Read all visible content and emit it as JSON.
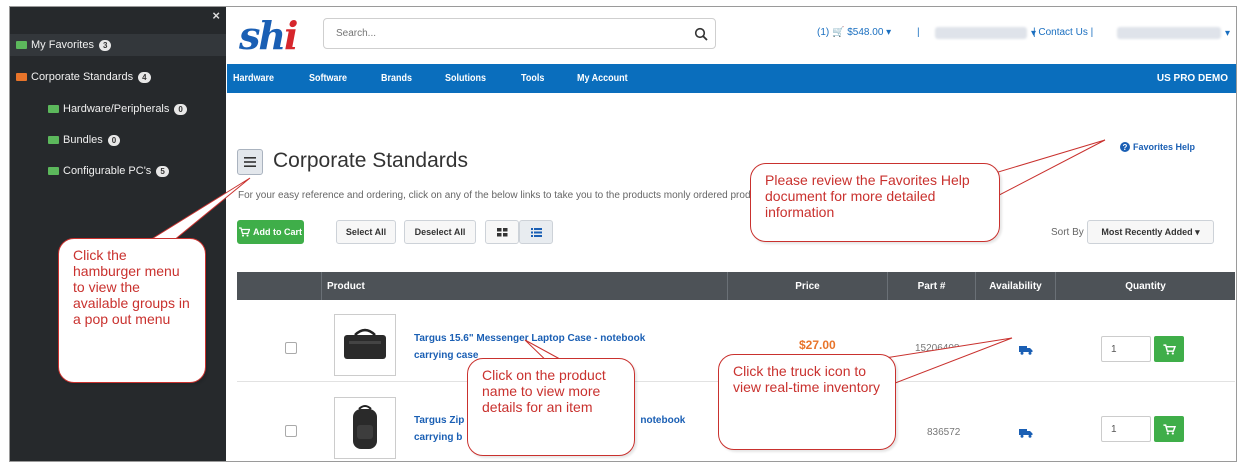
{
  "sidebar": {
    "close": "×",
    "items": [
      {
        "label": "My Favorites",
        "count": "3"
      },
      {
        "label": "Corporate Standards",
        "count": "4"
      },
      {
        "label": "Hardware/Peripherals",
        "count": "0"
      },
      {
        "label": "Bundles",
        "count": "0"
      },
      {
        "label": "Configurable PC's",
        "count": "5"
      }
    ]
  },
  "header": {
    "logo_text": "sh",
    "logo_i": "i",
    "search_placeholder": "Search...",
    "cart": "(1) 🛒 $548.00 ▾",
    "sep1": "|",
    "dropdown_caret": "▾",
    "contact": "| Contact Us |"
  },
  "nav": {
    "items": [
      "Hardware",
      "Software",
      "Brands",
      "Solutions",
      "Tools",
      "My Account"
    ],
    "right": "US PRO DEMO"
  },
  "page": {
    "title": "Corporate Standards",
    "description": "For your easy reference and ordering, click on any of the below links to take you to the products                                                                                                                     monly ordered products:",
    "favorites_help": "Favorites Help"
  },
  "toolbar": {
    "add_to_cart": "Add to Cart",
    "select_all": "Select All",
    "deselect_all": "Deselect All",
    "sort_label": "Sort By",
    "sort_value": "Most Recently Added ▾"
  },
  "table": {
    "headers": [
      "Product",
      "Price",
      "Part #",
      "Availability",
      "Quantity"
    ],
    "rows": [
      {
        "name_line1": "Targus 15.6\" Messenger Laptop Case - notebook",
        "name_line2": "carrying case",
        "price": "$27.00",
        "part": "15206408",
        "qty": "1"
      },
      {
        "name_line1": "Targus Zip",
        "name_line1b": "notebook",
        "name_line2": "carrying b",
        "price": "",
        "part": "836572",
        "qty": "1"
      }
    ]
  },
  "callouts": {
    "hamburger": "Click the hamburger menu to view the available groups in a pop out menu",
    "favorites": "Please review the Favorites Help document for more detailed information",
    "product": "Click on the product name to view more details for an item",
    "truck": "Click the truck icon to view real-time inventory"
  },
  "colors": {
    "sidebar_bg": "#26292c",
    "nav_bg": "#0a6ebd",
    "brand_blue": "#1a5fb4",
    "accent_green": "#3fae49",
    "price_orange": "#e8742a",
    "callout_red": "#c9312e"
  },
  "icons": [
    "close-icon",
    "folder-icon",
    "search-icon",
    "hamburger-icon",
    "help-icon",
    "cart-icon",
    "grid-view-icon",
    "list-view-icon",
    "truck-icon"
  ]
}
